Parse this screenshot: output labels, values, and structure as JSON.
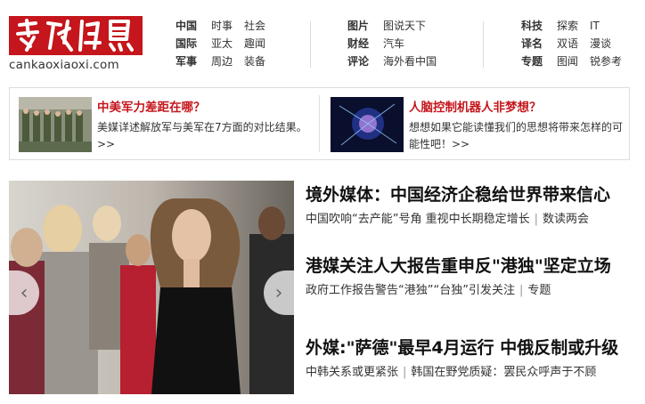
{
  "logo": {
    "cn": "参考消息",
    "domain": "cankaoxiaoxi.com"
  },
  "nav": [
    {
      "rows": [
        {
          "key": "中国",
          "subs": [
            "时事",
            "社会"
          ]
        },
        {
          "key": "国际",
          "subs": [
            "亚太",
            "趣闻"
          ]
        },
        {
          "key": "军事",
          "subs": [
            "周边",
            "装备"
          ]
        }
      ]
    },
    {
      "rows": [
        {
          "key": "图片",
          "subs": [
            "图说天下"
          ]
        },
        {
          "key": "财经",
          "subs": [
            "汽车"
          ]
        },
        {
          "key": "评论",
          "subs": [
            "海外看中国"
          ]
        }
      ]
    },
    {
      "rows": [
        {
          "key": "科技",
          "subs": [
            "探索",
            "IT"
          ]
        },
        {
          "key": "译名",
          "subs": [
            "双语",
            "漫谈"
          ]
        },
        {
          "key": "专题",
          "subs": [
            "图闻",
            "锐参考"
          ]
        }
      ]
    }
  ],
  "features": [
    {
      "title": "中美军力差距在哪？",
      "desc": "美媒详述解放军与美军在7方面的对比结果。>>"
    },
    {
      "title": "人脑控制机器人非梦想？",
      "desc": "想想如果它能读懂我们的思想将带来怎样的可能性吧！>>"
    }
  ],
  "slider": {
    "prev": "‹",
    "next": "›"
  },
  "headlines": [
    {
      "title": "境外媒体：中国经济企稳给世界带来信心",
      "subs": [
        "中国吹响“去产能”号角 重视中长期稳定增长",
        "数读两会"
      ]
    },
    {
      "title": "港媒关注人大报告重申反\"港独\"坚定立场",
      "subs": [
        "政府工作报告警告“港独”“台独”引发关注",
        "专题"
      ]
    },
    {
      "title": "外媒:\"萨德\"最早4月运行 中俄反制或升级",
      "subs": [
        "中韩关系或更紧张",
        "韩国在野党质疑：罢民众呼声于不顾"
      ]
    }
  ]
}
